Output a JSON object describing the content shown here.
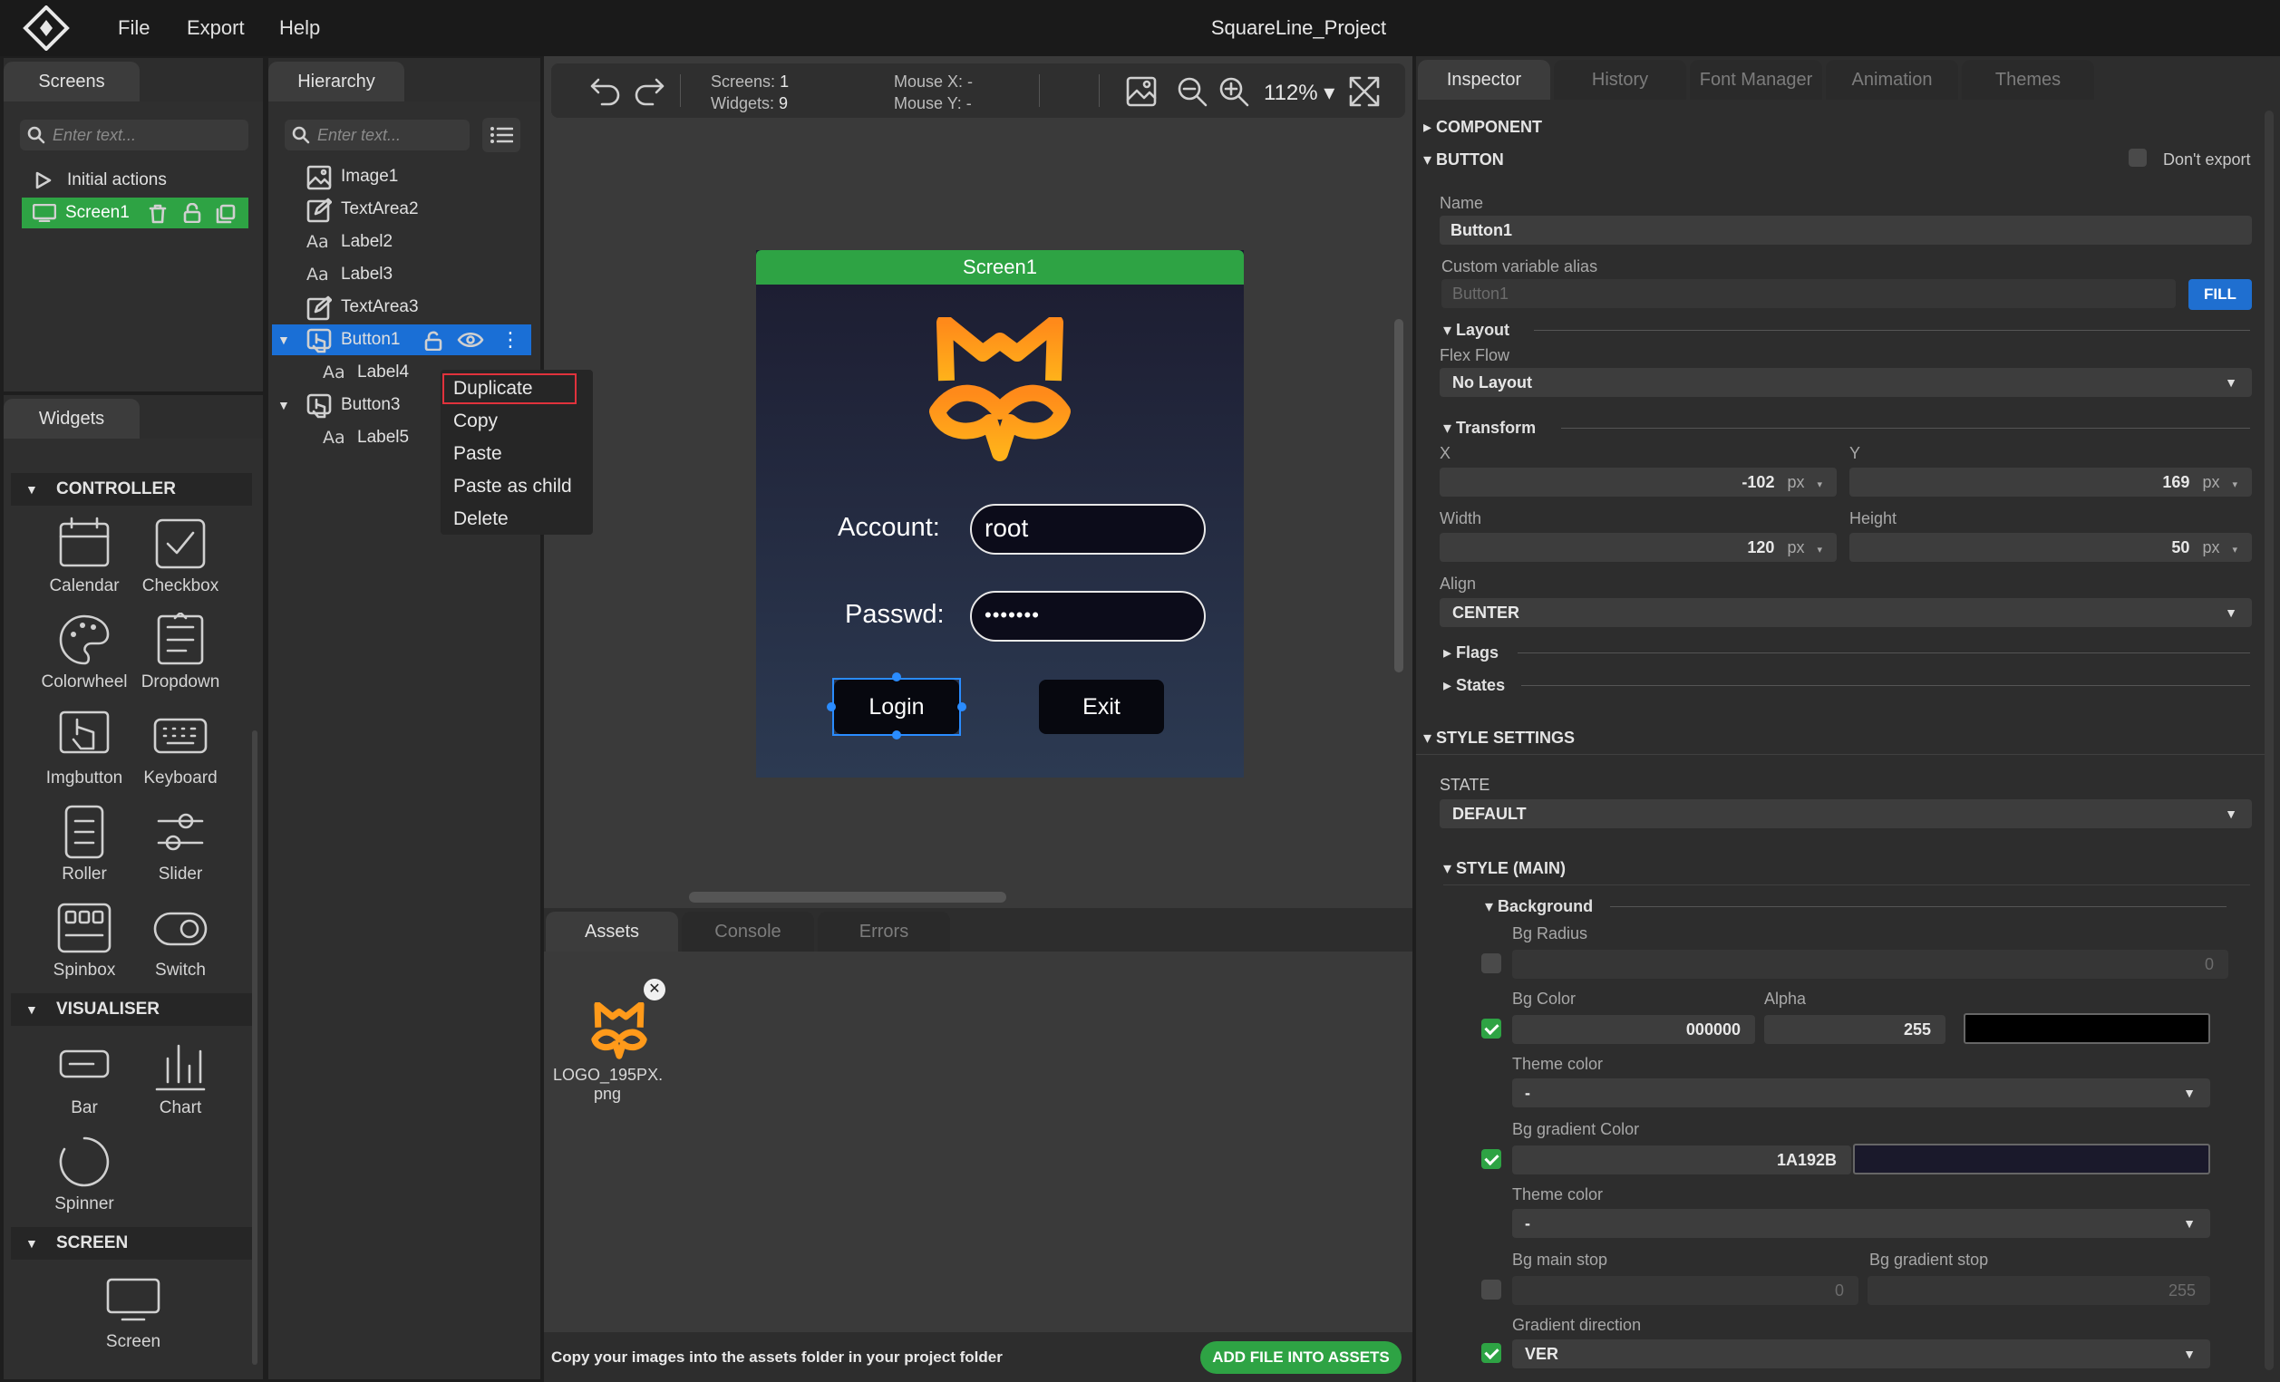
{
  "menubar": {
    "file": "File",
    "export": "Export",
    "help": "Help",
    "title": "SquareLine_Project"
  },
  "screens_panel": {
    "tab": "Screens",
    "search_placeholder": "Enter text...",
    "items": [
      {
        "label": "Initial actions"
      },
      {
        "label": "Screen1"
      }
    ]
  },
  "hierarchy_panel": {
    "tab": "Hierarchy",
    "search_placeholder": "Enter text...",
    "items": [
      {
        "label": "Image1"
      },
      {
        "label": "TextArea2"
      },
      {
        "label": "Label2"
      },
      {
        "label": "Label3"
      },
      {
        "label": "TextArea3"
      },
      {
        "label": "Button1"
      },
      {
        "label": "Label4"
      },
      {
        "label": "Button3"
      },
      {
        "label": "Label5"
      }
    ]
  },
  "context_menu": {
    "items": [
      "Duplicate",
      "Copy",
      "Paste",
      "Paste as child",
      "Delete"
    ]
  },
  "widgets_panel": {
    "tab": "Widgets",
    "controller": "CONTROLLER",
    "controller_items": [
      "Calendar",
      "Checkbox",
      "Colorwheel",
      "Dropdown",
      "Imgbutton",
      "Keyboard",
      "Roller",
      "Slider",
      "Spinbox",
      "Switch"
    ],
    "visualiser": "VISUALISER",
    "visualiser_items": [
      "Bar",
      "Chart",
      "Spinner"
    ],
    "screen": "SCREEN",
    "screen_items": [
      "Screen"
    ]
  },
  "toolbar": {
    "screens_label": "Screens:",
    "screens_value": "1",
    "widgets_label": "Widgets:",
    "widgets_value": "9",
    "mouse_x": "Mouse X: -",
    "mouse_y": "Mouse Y: -",
    "zoom": "112%"
  },
  "screen_preview": {
    "title": "Screen1",
    "account_label": "Account:",
    "account_value": "root",
    "passwd_label": "Passwd:",
    "passwd_value": "•••••••",
    "login": "Login",
    "exit": "Exit"
  },
  "bottom_panel": {
    "tabs": [
      "Assets",
      "Console",
      "Errors"
    ],
    "asset_name": "LOGO_195PX.\npng",
    "footer_text": "Copy your images into the assets folder in your project folder",
    "add_button": "ADD FILE INTO ASSETS"
  },
  "inspector": {
    "tabs": [
      "Inspector",
      "History",
      "Font Manager",
      "Animation",
      "Themes"
    ],
    "component": "COMPONENT",
    "button": "BUTTON",
    "dont_export": "Don't export",
    "name_label": "Name",
    "name_value": "Button1",
    "alias_label": "Custom variable alias",
    "alias_value": "Button1",
    "fill": "FILL",
    "layout": "Layout",
    "flex_flow_label": "Flex Flow",
    "flex_flow_value": "No Layout",
    "transform": "Transform",
    "x_label": "X",
    "x_value": "-102",
    "y_label": "Y",
    "y_value": "169",
    "width_label": "Width",
    "width_value": "120",
    "height_label": "Height",
    "height_value": "50",
    "unit": "px",
    "align_label": "Align",
    "align_value": "CENTER",
    "flags": "Flags",
    "states": "States",
    "style_settings": "STYLE SETTINGS",
    "state_label": "STATE",
    "state_value": "DEFAULT",
    "style_main": "STYLE (MAIN)",
    "background": "Background",
    "bg_radius_label": "Bg Radius",
    "bg_radius_value": "0",
    "bg_color_label": "Bg Color",
    "bg_color_value": "000000",
    "alpha_label": "Alpha",
    "alpha_value": "255",
    "theme_color_label": "Theme color",
    "theme_color_value": "-",
    "bg_grad_label": "Bg gradient Color",
    "bg_grad_value": "1A192B",
    "theme_color2_label": "Theme color",
    "theme_color2_value": "-",
    "bg_main_stop_label": "Bg main stop",
    "bg_main_stop_value": "0",
    "bg_grad_stop_label": "Bg gradient stop",
    "bg_grad_stop_value": "255",
    "grad_dir_label": "Gradient direction",
    "grad_dir_value": "VER"
  },
  "colors": {
    "accent_green": "#2ea344",
    "selection_blue": "#1a6fd6",
    "fill_blue": "#1f6fd0",
    "highlight_red": "#e0323c",
    "swatch_black": "#000000",
    "swatch_grad": "#1a192b"
  }
}
